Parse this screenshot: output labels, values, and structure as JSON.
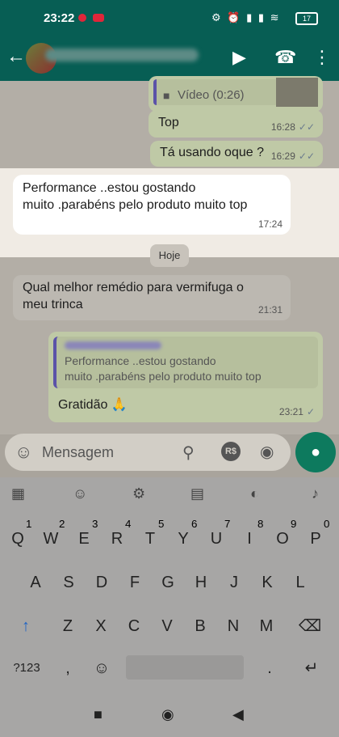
{
  "status_bar": {
    "time": "23:22",
    "battery": "17"
  },
  "app_bar": {
    "back": "←",
    "video_call_icon": "video-camera-icon",
    "call_icon": "phone-icon",
    "menu_icon": "more-vert-icon"
  },
  "messages": {
    "video_label": "Vídeo (0:26)",
    "top_msg": {
      "text": "Top",
      "time": "16:28",
      "status": "✓✓"
    },
    "usando_msg": {
      "text": "Tá usando oque ?",
      "time": "16:29",
      "status": "✓✓"
    },
    "highlighted_msg": {
      "line1": "Performance  ..estou gostando",
      "line2": "muito .parabéns  pelo produto muito top",
      "time": "17:24"
    },
    "date_chip": "Hoje",
    "remedio_msg": {
      "line1": "Qual melhor remédio para vermifuga  o",
      "line2": "meu trinca",
      "time": "21:31"
    },
    "reply_msg": {
      "quote_line1": "Performance  ..estou gostando",
      "quote_line2": "muito .parabéns  pelo produto muito top",
      "text": "Gratidão 🙏",
      "time": "23:21",
      "status": "✓"
    }
  },
  "input": {
    "placeholder": "Mensagem",
    "rs_label": "R$"
  },
  "keyboard": {
    "row1": [
      "Q",
      "W",
      "E",
      "R",
      "T",
      "Y",
      "U",
      "I",
      "O",
      "P"
    ],
    "row1_hints": [
      "1",
      "2",
      "3",
      "4",
      "5",
      "6",
      "7",
      "8",
      "9",
      "0"
    ],
    "row2": [
      "A",
      "S",
      "D",
      "F",
      "G",
      "H",
      "J",
      "K",
      "L"
    ],
    "row3": [
      "Z",
      "X",
      "C",
      "V",
      "B",
      "N",
      "M"
    ],
    "symbols_key": "?123",
    "comma": ",",
    "period": "."
  },
  "colors": {
    "header": "#075e54",
    "outgoing": "#bfc9a6",
    "mic_fab": "#0d7a5e"
  }
}
